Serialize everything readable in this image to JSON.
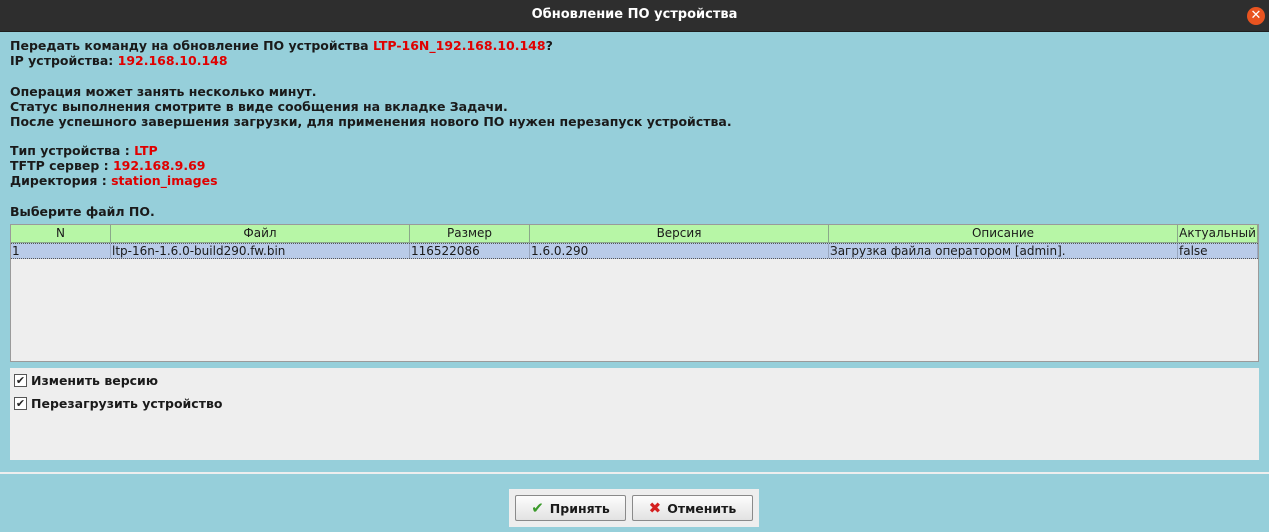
{
  "window": {
    "title": "Обновление ПО устройства",
    "close_symbol": "✕"
  },
  "info": {
    "command_prefix": "Передать команду на обновление ПО устройства ",
    "device_name": "LTP-16N_192.168.10.148",
    "command_suffix": "?",
    "ip_label": "IP устройства: ",
    "ip_value": "192.168.10.148",
    "note_1": "Операция может занять несколько минут.",
    "note_2": "Статус выполнения смотрите в виде сообщения на вкладке Задачи.",
    "note_3": "После успешного завершения загрузки, для применения нового ПО нужен перезапуск устройства.",
    "device_type_label": "Тип устройства : ",
    "device_type_value": "LTP",
    "tftp_label": "TFTP сервер : ",
    "tftp_value": "192.168.9.69",
    "dir_label": "Директория : ",
    "dir_value": "station_images",
    "select_file_label": "Выберите файл ПО."
  },
  "table": {
    "columns": [
      "N",
      "Файл",
      "Размер",
      "Версия",
      "Описание",
      "Актуальный"
    ],
    "rows": [
      {
        "n": "1",
        "file": "ltp-16n-1.6.0-build290.fw.bin",
        "size": "116522086",
        "version": "1.6.0.290",
        "description": "Загрузка файла оператором [admin].",
        "actual": "false"
      }
    ]
  },
  "options": {
    "change_version": {
      "label": "Изменить версию",
      "checked": true
    },
    "reboot_device": {
      "label": "Перезагрузить устройство",
      "checked": true
    },
    "check_mark": "✔"
  },
  "buttons": {
    "accept": {
      "label": "Принять",
      "icon": "check-icon",
      "glyph": "✔"
    },
    "cancel": {
      "label": "Отменить",
      "icon": "cross-icon",
      "glyph": "✖"
    }
  },
  "colors": {
    "background": "#96cfda",
    "header_green": "#b7f6a6",
    "selected_row": "#b9cbe8",
    "accent_red": "#e00000",
    "close_orange": "#e95420"
  }
}
